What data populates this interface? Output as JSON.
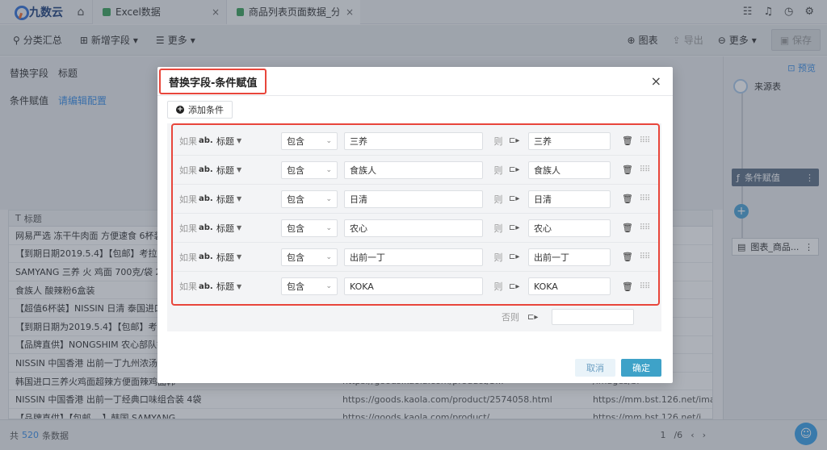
{
  "app": {
    "logo": "九数云"
  },
  "tabs": [
    {
      "label": "Excel数据",
      "close": "×"
    },
    {
      "label": "商品列表页面数据_分...",
      "close": "×"
    }
  ],
  "toolbar": {
    "group_summary": "分类汇总",
    "add_field": "新增字段",
    "more": "更多",
    "chart": "图表",
    "export": "导出",
    "more_right": "更多",
    "save": "保存"
  },
  "config": {
    "replace_field_label": "替换字段",
    "replace_field_value": "标题",
    "cond_assign_label": "条件赋值",
    "cond_assign_link": "请编辑配置"
  },
  "table": {
    "column_header": "标题",
    "rows": [
      {
        "title": "网易严选 冻干牛肉面 方便速食 6杯装",
        "url": "",
        "img": "net/26261"
      },
      {
        "title": "【到期日期2019.5.4】【包邮】考拉工厂",
        "url": "",
        "img": "27.net/97"
      },
      {
        "title": "SAMYANG 三养 火 鸡面 700克/袋 2袋装",
        "url": "",
        "img": "net/9ea18"
      },
      {
        "title": "食族人 酸辣粉6盒装",
        "url": "",
        "img": "net/57628"
      },
      {
        "title": "【超值6杯装】NISSIN 日清 泰国进口杯",
        "url": "",
        "img": "/images/bl"
      },
      {
        "title": "【到期日期为2019.5.4】【包邮】考拉工",
        "url": "",
        "img": "/images/bl"
      },
      {
        "title": "【品牌直供】NONGSHIM 农心部队锅 拉",
        "url": "",
        "img": "/images/bl"
      },
      {
        "title": "NISSIN 中国香港 出前一丁九州浓汤猪骨",
        "url": "",
        "img": "/images/bl"
      },
      {
        "title": "韩国进口三养火鸡面超辣方便面辣鸡面韩",
        "url": "https://goods.kaola.com/product/3...",
        "img": "/images/bl"
      },
      {
        "title": "NISSIN 中国香港 出前一丁经典口味组合装 4袋",
        "url": "https://goods.kaola.com/product/2574058.html",
        "img": "https://mm.bst.126.net/images/bl"
      },
      {
        "title": "【品牌直供】【包邮 ...】韩国 SAMYANG...",
        "url": "https://goods.kaola.com/product/...",
        "img": "https://mm.bst.126.net/i..."
      }
    ]
  },
  "right_panel": {
    "preview": "预览",
    "source": "来源表",
    "cond_node": "条件赋值",
    "plus": "+",
    "chart_node": "图表_商品..."
  },
  "footer": {
    "total_prefix": "共",
    "total_count": "520",
    "total_suffix": "条数据",
    "page": "1",
    "pages": "/6"
  },
  "modal": {
    "title": "替换字段-条件赋值",
    "close": "×",
    "add_condition": "添加条件",
    "conditions": [
      {
        "if": "如果",
        "type": "ab.",
        "field": "标题",
        "op": "包含",
        "value": "三养",
        "then": "则",
        "result": "三养"
      },
      {
        "if": "如果",
        "type": "ab.",
        "field": "标题",
        "op": "包含",
        "value": "食族人",
        "then": "则",
        "result": "食族人"
      },
      {
        "if": "如果",
        "type": "ab.",
        "field": "标题",
        "op": "包含",
        "value": "日清",
        "then": "则",
        "result": "日清"
      },
      {
        "if": "如果",
        "type": "ab.",
        "field": "标题",
        "op": "包含",
        "value": "农心",
        "then": "则",
        "result": "农心"
      },
      {
        "if": "如果",
        "type": "ab.",
        "field": "标题",
        "op": "包含",
        "value": "出前一丁",
        "then": "则",
        "result": "出前一丁"
      },
      {
        "if": "如果",
        "type": "ab.",
        "field": "标题",
        "op": "包含",
        "value": "KOKA",
        "then": "则",
        "result": "KOKA"
      }
    ],
    "else_label": "否则",
    "else_value": "",
    "cancel": "取消",
    "ok": "确定"
  }
}
